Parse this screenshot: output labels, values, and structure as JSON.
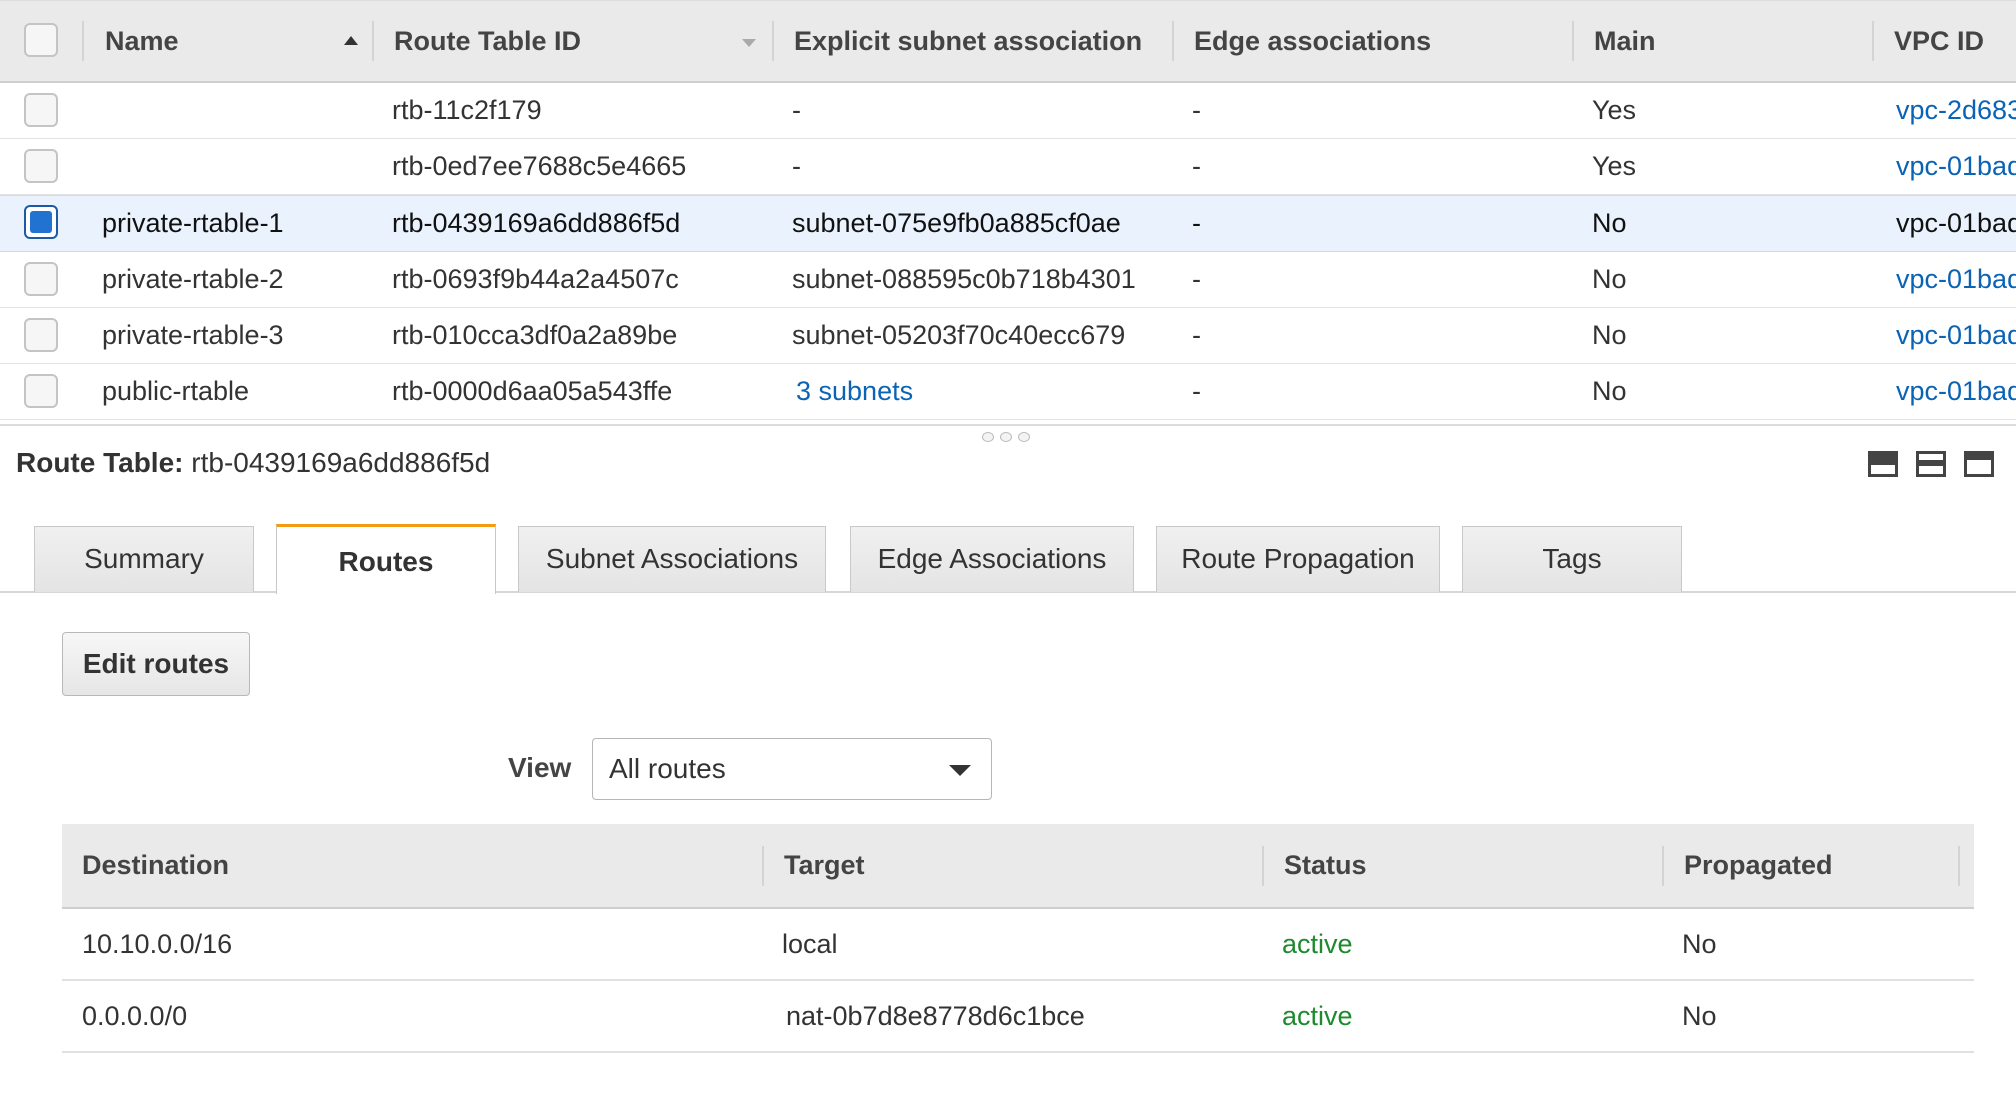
{
  "route_tables": {
    "columns": [
      "Name",
      "Route Table ID",
      "Explicit subnet association",
      "Edge associations",
      "Main",
      "VPC ID"
    ],
    "rows": [
      {
        "name": "",
        "id": "rtb-11c2f179",
        "subnet": "-",
        "edge": "-",
        "main": "Yes",
        "vpc": "vpc-2d683",
        "selected": false
      },
      {
        "name": "",
        "id": "rtb-0ed7ee7688c5e4665",
        "subnet": "-",
        "edge": "-",
        "main": "Yes",
        "vpc": "vpc-01bad",
        "selected": false
      },
      {
        "name": "private-rtable-1",
        "id": "rtb-0439169a6dd886f5d",
        "subnet": "subnet-075e9fb0a885cf0ae",
        "edge": "-",
        "main": "No",
        "vpc": "vpc-01bad",
        "selected": true
      },
      {
        "name": "private-rtable-2",
        "id": "rtb-0693f9b44a2a4507c",
        "subnet": "subnet-088595c0b718b4301",
        "edge": "-",
        "main": "No",
        "vpc": "vpc-01bad",
        "selected": false
      },
      {
        "name": "private-rtable-3",
        "id": "rtb-010cca3df0a2a89be",
        "subnet": "subnet-05203f70c40ecc679",
        "edge": "-",
        "main": "No",
        "vpc": "vpc-01bad",
        "selected": false
      },
      {
        "name": "public-rtable",
        "id": "rtb-0000d6aa05a543ffe",
        "subnet": "3 subnets",
        "edge": "-",
        "main": "No",
        "vpc": "vpc-01bad",
        "selected": false
      }
    ]
  },
  "detail": {
    "label": "Route Table:",
    "value": "rtb-0439169a6dd886f5d"
  },
  "tabs": [
    "Summary",
    "Routes",
    "Subnet Associations",
    "Edge Associations",
    "Route Propagation",
    "Tags"
  ],
  "active_tab": "Routes",
  "routes_panel": {
    "edit_button": "Edit routes",
    "view_label": "View",
    "view_selected": "All routes",
    "columns": [
      "Destination",
      "Target",
      "Status",
      "Propagated"
    ],
    "rows": [
      {
        "destination": "10.10.0.0/16",
        "target": "local",
        "target_is_link": false,
        "status": "active",
        "propagated": "No"
      },
      {
        "destination": "0.0.0.0/0",
        "target": "nat-0b7d8e8778d6c1bce",
        "target_is_link": true,
        "status": "active",
        "propagated": "No"
      }
    ]
  },
  "colors": {
    "link": "#0b63b5",
    "status_active": "#1d8a2e",
    "active_tab_accent": "#f39c12",
    "selected_row": "#eaf3fd",
    "checkbox_checked": "#2272d2"
  },
  "icons": [
    "sort-asc-icon",
    "sort-desc-icon",
    "panel-layout-bottom-icon",
    "panel-layout-half-icon",
    "panel-layout-top-icon",
    "dropdown-caret-icon",
    "splitter-grip-icon"
  ]
}
